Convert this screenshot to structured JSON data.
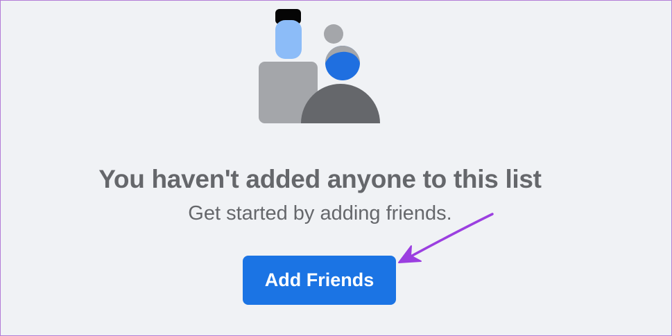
{
  "empty_state": {
    "illustration_icon": "friends-people-icon",
    "title": "You haven't added anyone to this list",
    "subtitle": "Get started by adding friends."
  },
  "actions": {
    "add_friends_label": "Add Friends"
  },
  "annotation": {
    "arrow_icon": "purple-pointer-arrow-icon",
    "arrow_color": "#9b3fe0"
  },
  "colors": {
    "background": "#f0f2f5",
    "accent": "#1b74e4",
    "text": "#65676b",
    "frame_border": "#b27cd6"
  }
}
